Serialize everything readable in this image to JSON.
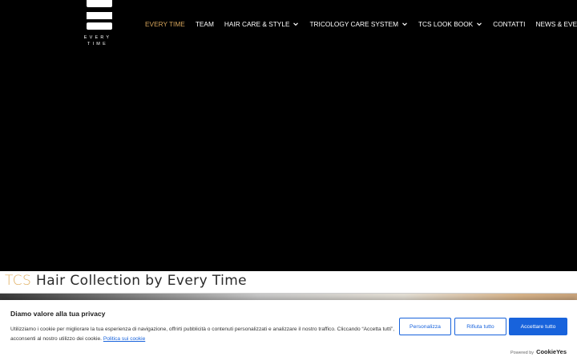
{
  "brand": {
    "logo_line1": "EVERY",
    "logo_line2": "TIME"
  },
  "nav": {
    "items": [
      {
        "label": "EVERY TIME",
        "active": true,
        "dropdown": false
      },
      {
        "label": "TEAM",
        "active": false,
        "dropdown": false
      },
      {
        "label": "HAIR CARE & STYLE",
        "active": false,
        "dropdown": true
      },
      {
        "label": "TRICOLOGY CARE SYSTEM",
        "active": false,
        "dropdown": true
      },
      {
        "label": "TCS LOOK BOOK",
        "active": false,
        "dropdown": true
      },
      {
        "label": "CONTATTI",
        "active": false,
        "dropdown": false
      },
      {
        "label": "NEWS & EVENTI",
        "active": false,
        "dropdown": false
      }
    ],
    "dropdown_icon": "chevron-down-icon"
  },
  "hero": {
    "title_accent": "TCS",
    "title_rest": " Hair Collection by Every Time"
  },
  "cookie_banner": {
    "heading": "Diamo valore alla tua privacy",
    "text": "Utilizziamo i cookie per migliorare la tua esperienza di navigazione, offrirti pubblicità o contenuti personalizzati e analizzare il nostro traffico. Cliccando “Accetta tutti”, acconsenti al nostro utilizzo dei cookie.",
    "policy_link": "Politica sui cookie",
    "buttons": {
      "customize": "Personalizza",
      "reject": "Rifiuta tutto",
      "accept": "Accettare tutto"
    },
    "powered_by": "Powered by",
    "powered_brand": "CookieYes"
  },
  "colors": {
    "background": "#000000",
    "nav_active": "#d4a35a",
    "title_accent": "#e0b063",
    "button_primary": "#1863dc"
  }
}
